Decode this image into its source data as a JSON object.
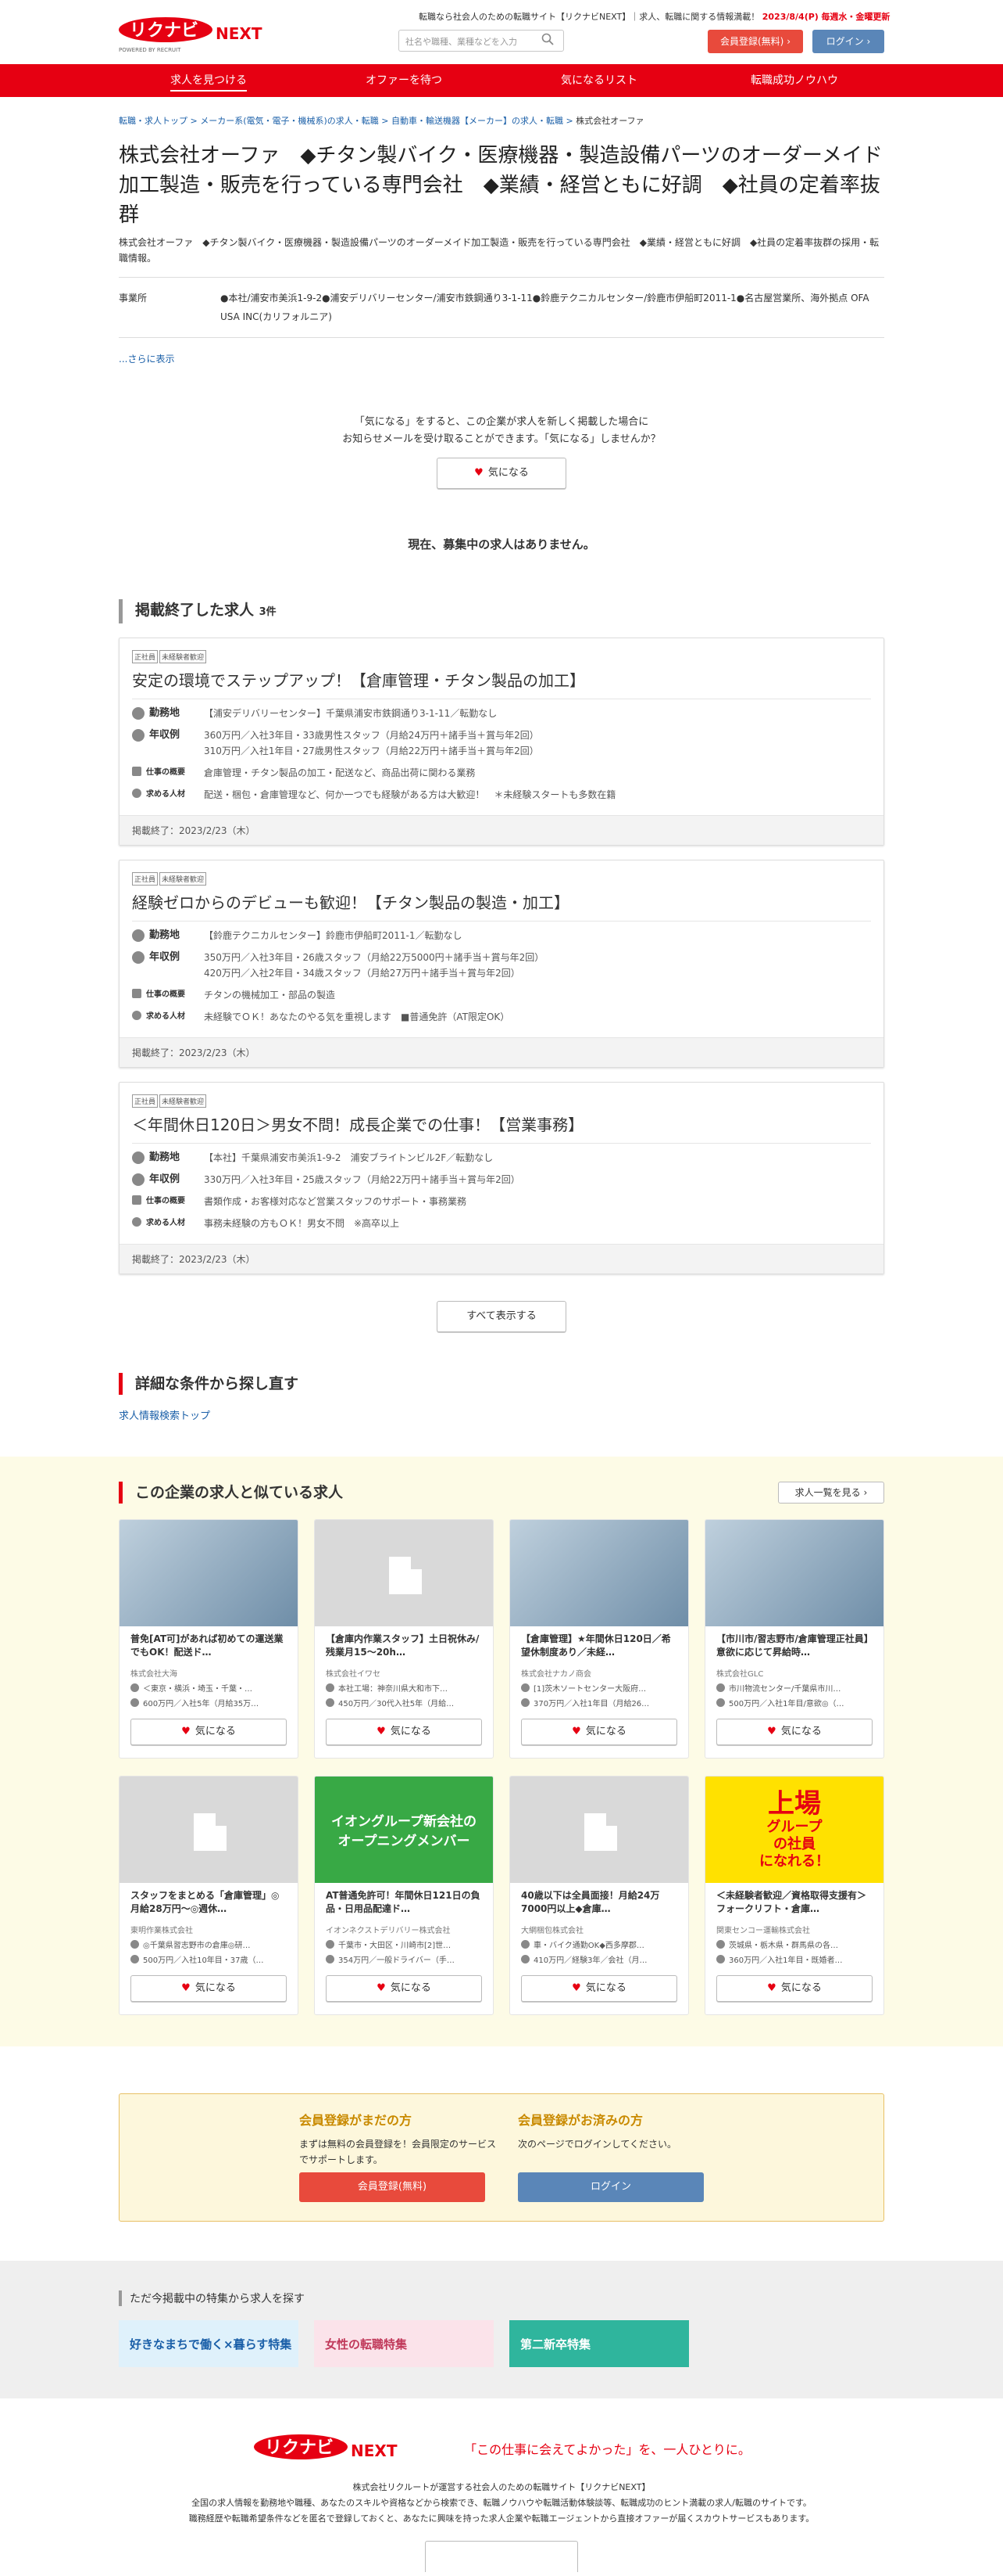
{
  "header": {
    "tagline": "転職なら社会人のための転職サイト【リクナビNEXT】｜求人、転職に関する情報満載！",
    "update": "2023/8/4(P)",
    "update_suffix": "毎週水・金曜更新",
    "search_placeholder": "社名や職種、業種などを入力",
    "register_label": "会員登録(無料)",
    "login_label": "ログイン",
    "logo_text": "リクナビNEXT",
    "powered": "POWERED BY RECRUIT"
  },
  "nav": [
    "求人を見つける",
    "オファーを待つ",
    "気になるリスト",
    "転職成功ノウハウ"
  ],
  "breadcrumb": [
    "転職・求人トップ",
    "メーカー系(電気・電子・機械系)の求人・転職",
    "自動車・輸送機器【メーカー】の求人・転職",
    "株式会社オーファ"
  ],
  "title": "株式会社オーファ　◆チタン製バイク・医療機器・製造設備パーツのオーダーメイド加工製造・販売を行っている専門会社　◆業績・経営ともに好調　◆社員の定着率抜群",
  "subdesc": "株式会社オーファ　◆チタン製バイク・医療機器・製造設備パーツのオーダーメイド加工製造・販売を行っている専門会社　◆業績・経営ともに好調　◆社員の定着率抜群の採用・転職情報。",
  "office": {
    "label": "事業所",
    "value": "●本社/浦安市美浜1-9-2●浦安デリバリーセンター/浦安市鉄鋼通り3-1-11●鈴鹿テクニカルセンター/鈴鹿市伊船町2011-1●名古屋営業所、海外拠点 OFA USA INC(カリフォルニア)"
  },
  "more_label": "...さらに表示",
  "fav_intro": [
    "「気になる」をすると、この企業が求人を新しく掲載した場合に",
    "お知らせメールを受け取ることができます。「気になる」しませんか？"
  ],
  "fav_label": "気になる",
  "none_msg": "現在、募集中の求人はありません。",
  "ended": {
    "heading": "掲載終了した求人",
    "count": "3件",
    "labels": {
      "loc": "勤務地",
      "pay": "年収例",
      "work": "仕事の概要",
      "req": "求める人材"
    },
    "jobs": [
      {
        "tags": [
          "正社員",
          "未経験者歓迎"
        ],
        "title": "安定の環境でステップアップ！【倉庫管理・チタン製品の加工】",
        "loc": "【浦安デリバリーセンター】千葉県浦安市鉄鋼通り3-1-11／転勤なし",
        "pay": [
          "360万円／入社3年目・33歳男性スタッフ（月給24万円＋諸手当＋賞与年2回）",
          "310万円／入社1年目・27歳男性スタッフ（月給22万円＋諸手当＋賞与年2回）"
        ],
        "work": "倉庫管理・チタン製品の加工・配送など、商品出荷に関わる業務",
        "req": "配送・梱包・倉庫管理など、何か一つでも経験がある方は大歓迎！　＊未経験スタートも多数在籍",
        "end": "掲載終了：2023/2/23（木）"
      },
      {
        "tags": [
          "正社員",
          "未経験者歓迎"
        ],
        "title": "経験ゼロからのデビューも歓迎！【チタン製品の製造・加工】",
        "loc": "【鈴鹿テクニカルセンター】鈴鹿市伊船町2011-1／転勤なし",
        "pay": [
          "350万円／入社3年目・26歳スタッフ（月給22万5000円＋諸手当＋賞与年2回）",
          "420万円／入社2年目・34歳スタッフ（月給27万円＋諸手当＋賞与年2回）"
        ],
        "work": "チタンの機械加工・部品の製造",
        "req": "未経験でＯＫ！あなたのやる気を重視します　■普通免許（AT限定OK）",
        "end": "掲載終了：2023/2/23（木）"
      },
      {
        "tags": [
          "正社員",
          "未経験者歓迎"
        ],
        "title": "＜年間休日120日＞男女不問！成長企業での仕事！【営業事務】",
        "loc": "【本社】千葉県浦安市美浜1-9-2　浦安ブライトンビル2F／転勤なし",
        "pay": [
          "330万円／入社3年目・25歳スタッフ（月給22万円＋諸手当＋賞与年2回）"
        ],
        "work": "書類作成・お客様対応など営業スタッフのサポート・事務業務",
        "req": "事務未経験の方もＯＫ！男女不問　※高卒以上",
        "end": "掲載終了：2023/2/23（木）"
      }
    ],
    "show_all": "すべて表示する"
  },
  "detail": {
    "heading": "詳細な条件から探し直す",
    "link": "求人情報検索トップ"
  },
  "similar": {
    "heading": "この企業の求人と似ている求人",
    "list_btn": "求人一覧を見る",
    "items": [
      {
        "img": "photo",
        "title": "普免[AT可]があれば初めての運送業でもOK！配送ド…",
        "co": "株式会社大海",
        "loc": "＜東京・横浜・埼玉・千葉・…",
        "pay": "600万円／入社5年（月給35万…"
      },
      {
        "img": "bldg",
        "title": "【倉庫内作業スタッフ】土日祝休み/残業月15〜20h…",
        "co": "株式会社イワセ",
        "loc": "本社工場：神奈川県大和市下…",
        "pay": "450万円／30代入社5年（月給…"
      },
      {
        "img": "photo",
        "title": "【倉庫管理】★年間休日120日／希望休制度あり／未経…",
        "co": "株式会社ナカノ商会",
        "loc": "[1]茨木ソートセンター大阪府…",
        "pay": "370万円／入社1年目（月給26…"
      },
      {
        "img": "photo",
        "title": "【市川市/習志野市/倉庫管理正社員】意欲に応じて昇給時…",
        "co": "株式会社GLC",
        "loc": "市川物流センター/千葉県市川…",
        "pay": "500万円／入社1年目/意欲◎（…"
      },
      {
        "img": "bldg",
        "title": "スタッフをまとめる「倉庫管理」◎月給28万円〜◎週休…",
        "co": "東明作業株式会社",
        "loc": "◎千葉県習志野市の倉庫◎研…",
        "pay": "500万円／入社10年目・37歳（…"
      },
      {
        "img": "green",
        "img_text": [
          "イオングループ新会社の",
          "オープニングメンバー"
        ],
        "title": "AT普通免許可！年間休日121日の負品・日用品配達ド…",
        "co": "イオンネクストデリバリー株式会社",
        "loc": "千葉市・大田区・川崎市[2]世…",
        "pay": "354万円／一般ドライバー（手…"
      },
      {
        "img": "bldg",
        "title": "40歳以下は全員面接！月給24万7000円以上◆倉庫…",
        "co": "大網梱包株式会社",
        "loc": "車・バイク通勤OK◆西多摩郡…",
        "pay": "410万円／経験3年／会社（月…"
      },
      {
        "img": "yellow",
        "img_text": [
          "上場",
          "グループ",
          "の社員",
          "になれる！"
        ],
        "title": "＜未経験者歓迎／資格取得支援有＞フォークリフト・倉庫…",
        "co": "関東センコー運輸株式会社",
        "loc": "茨城県・栃木県・群馬県の各…",
        "pay": "360万円／入社1年目・既婚者…"
      }
    ]
  },
  "member": {
    "not_yet": {
      "heading": "会員登録がまだの方",
      "text": "まずは無料の会員登録を！会員限定のサービスでサポートします。",
      "btn": "会員登録(無料)"
    },
    "done": {
      "heading": "会員登録がお済みの方",
      "text": "次のページでログインしてください。",
      "btn": "ログイン"
    }
  },
  "features": {
    "heading": "ただ今掲載中の特集から求人を探す",
    "banners": [
      {
        "text": "好きなまちで働く×暮らす特集",
        "color": "#dff1fb"
      },
      {
        "text": "女性の転職特集",
        "color": "#fbe3ea"
      },
      {
        "text": "第二新卒特集",
        "color": "#2fb59d"
      }
    ]
  },
  "footer": {
    "slogan": "「この仕事に会えてよかった」を、一人ひとりに。",
    "lines": [
      "株式会社リクルートが運営する社会人のための転職サイト【リクナビNEXT】",
      "全国の求人情報を勤務地や職種、あなたのスキルや資格などから検索でき、転職ノウハウや転職活動体験談等、転職成功のヒント満載の求人/転職のサイトです。",
      "職務経歴や転職希望条件などを匿名で登録しておくと、あなたに興味を持った求人企業や転職エージェントから直接オファーが届くスカウトサービスもあります。"
    ]
  },
  "colors": {
    "brand": "#e60012",
    "login": "#5a86b8"
  }
}
